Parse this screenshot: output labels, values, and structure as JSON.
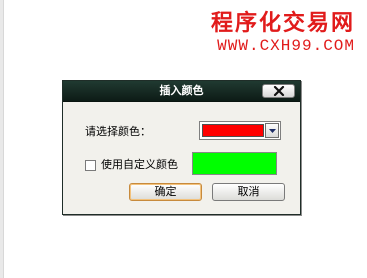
{
  "watermark": {
    "title": "程序化交易网",
    "url": "WWW.CXH99.COM",
    "color": "#e11b1b"
  },
  "dialog": {
    "title": "插入颜色",
    "close_icon": "close-icon",
    "color_label": "请选择颜色：",
    "selected_color": "#ff0000",
    "dropdown_icon": "chevron-down-icon",
    "custom_label": "使用自定义颜色",
    "custom_checked": false,
    "custom_color": "#00ff00",
    "ok_label": "确定",
    "cancel_label": "取消",
    "title_bar_color": "#1a2f28",
    "ok_focus_color": "#c78a3d"
  }
}
